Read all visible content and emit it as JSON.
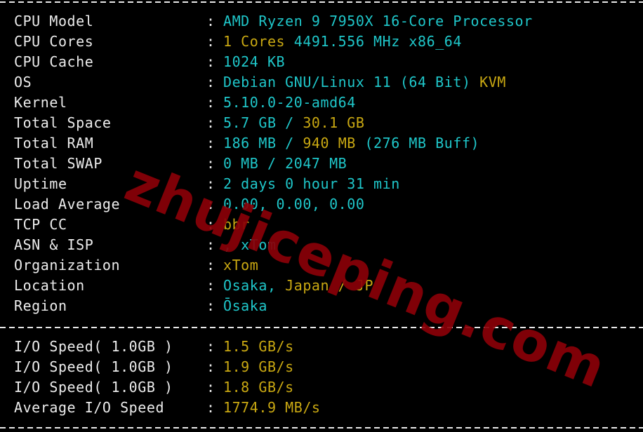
{
  "colors": {
    "background": "#000000",
    "label": "#ececec",
    "cyan": "#1fc6c9",
    "yellow": "#c9a812",
    "watermark": "#8a0008"
  },
  "separator": "----------------------------------------------------------------------",
  "system_info": [
    {
      "label": "CPU Model",
      "parts": [
        {
          "text": "AMD Ryzen 9 7950X 16-Core Processor",
          "color": "cyan"
        }
      ]
    },
    {
      "label": "CPU Cores",
      "parts": [
        {
          "text": "1 Cores",
          "color": "yellow"
        },
        {
          "text": " 4491.556 MHz x86_64",
          "color": "cyan"
        }
      ]
    },
    {
      "label": "CPU Cache",
      "parts": [
        {
          "text": "1024 KB",
          "color": "cyan"
        }
      ]
    },
    {
      "label": "OS",
      "parts": [
        {
          "text": "Debian GNU/Linux 11 (64 Bit) ",
          "color": "cyan"
        },
        {
          "text": "KVM",
          "color": "yellow"
        }
      ]
    },
    {
      "label": "Kernel",
      "parts": [
        {
          "text": "5.10.0-20-amd64",
          "color": "cyan"
        }
      ]
    },
    {
      "label": "Total Space",
      "parts": [
        {
          "text": "5.7 GB / ",
          "color": "cyan"
        },
        {
          "text": "30.1 GB",
          "color": "yellow"
        }
      ]
    },
    {
      "label": "Total RAM",
      "parts": [
        {
          "text": "186 MB / ",
          "color": "cyan"
        },
        {
          "text": "940 MB",
          "color": "yellow"
        },
        {
          "text": " (276 MB Buff)",
          "color": "cyan"
        }
      ]
    },
    {
      "label": "Total SWAP",
      "parts": [
        {
          "text": "0 MB / 2047 MB",
          "color": "cyan"
        }
      ]
    },
    {
      "label": "Uptime",
      "parts": [
        {
          "text": "2 days 0 hour 31 min",
          "color": "cyan"
        }
      ]
    },
    {
      "label": "Load Average",
      "parts": [
        {
          "text": "0.00, 0.00, 0.00",
          "color": "cyan"
        }
      ]
    },
    {
      "label": "TCP CC",
      "parts": [
        {
          "text": "bbr",
          "color": "yellow"
        }
      ]
    },
    {
      "label": "ASN & ISP",
      "parts": [
        {
          "text": ", xTom",
          "color": "cyan"
        }
      ]
    },
    {
      "label": "Organization",
      "parts": [
        {
          "text": "xTom",
          "color": "yellow"
        }
      ]
    },
    {
      "label": "Location",
      "parts": [
        {
          "text": "Osaka, ",
          "color": "cyan"
        },
        {
          "text": "Japan / JP",
          "color": "yellow"
        }
      ]
    },
    {
      "label": "Region",
      "parts": [
        {
          "text": "Ōsaka",
          "color": "cyan"
        }
      ]
    }
  ],
  "io_info": [
    {
      "label": "I/O Speed( 1.0GB )",
      "parts": [
        {
          "text": "1.5 GB/s",
          "color": "yellow"
        }
      ]
    },
    {
      "label": "I/O Speed( 1.0GB )",
      "parts": [
        {
          "text": "1.9 GB/s",
          "color": "yellow"
        }
      ]
    },
    {
      "label": "I/O Speed( 1.0GB )",
      "parts": [
        {
          "text": "1.8 GB/s",
          "color": "yellow"
        }
      ]
    },
    {
      "label": "Average I/O Speed",
      "parts": [
        {
          "text": "1774.9 MB/s",
          "color": "yellow"
        }
      ]
    }
  ],
  "colon": ":",
  "watermark": "zhujiceping.com"
}
